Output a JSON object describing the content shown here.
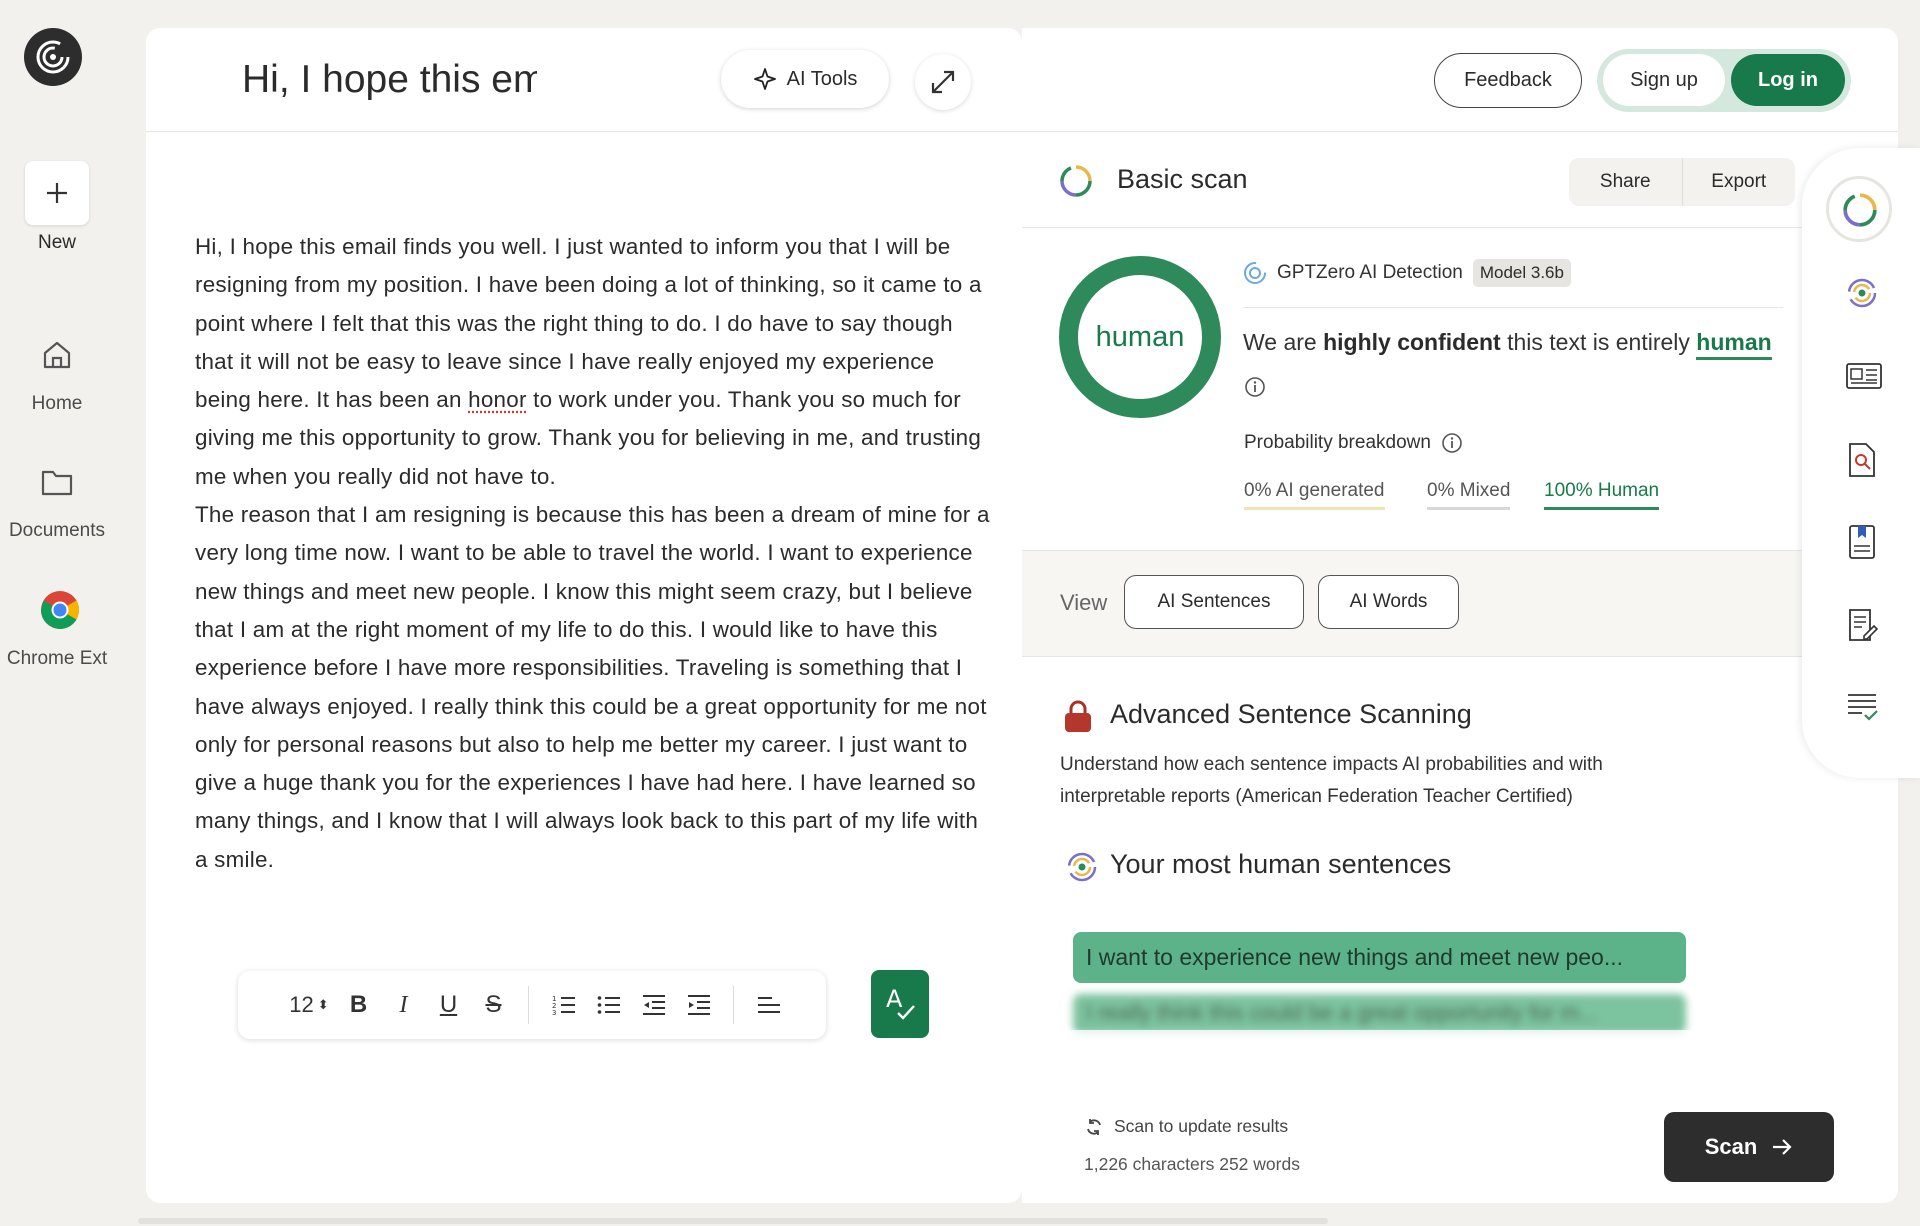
{
  "nav": {
    "new_label": "New",
    "home_label": "Home",
    "documents_label": "Documents",
    "chrome_label": "Chrome Ext"
  },
  "editor": {
    "title": "Hi, I hope this email",
    "ai_tools_label": "AI Tools",
    "body_p1_a": "Hi, I hope this email finds you well. I just wanted to inform you that I will be resigning from my position. I have been doing a lot of thinking, so it came to a point where I felt that this was the right thing to do. I do have to say though that it will not be easy to leave since I have really enjoyed my experience being here. It has been an ",
    "body_p1_flag": "honor",
    "body_p1_b": " to work under you. Thank you so much for giving me this opportunity to grow. Thank you for believing in me, and trusting me when you really did not have to.",
    "body_p2": "The reason that I am resigning is because this has been a dream of mine for a very long time now. I want to be able to travel the world. I want to experience new things and meet new people. I know this might seem crazy, but I believe that I am at the right moment of my life to do this. I would like to have this experience before I have more responsibilities. Traveling is something that I have always enjoyed. I really think this could be a great opportunity for me not only for personal reasons but also to help me better my career. I just want to give a huge thank you for the experiences I have had here. I have learned so many things, and I know that I will always look back to this part of my life with a smile.",
    "font_size": "12"
  },
  "header": {
    "feedback_label": "Feedback",
    "signup_label": "Sign up",
    "login_label": "Log in"
  },
  "scan": {
    "title": "Basic scan",
    "share_label": "Share",
    "export_label": "Export",
    "gauge_label": "human",
    "detector_name": "GPTZero AI Detection",
    "model_badge": "Model 3.6b",
    "confidence_prefix": "We are ",
    "confidence_strong": "highly confident",
    "confidence_middle": " this text is entirely ",
    "confidence_verdict": "human",
    "prob_label": "Probability breakdown",
    "prob_ai": "0% AI generated",
    "prob_mixed": "0% Mixed",
    "prob_human": "100% Human",
    "view_label": "View",
    "chip_sentences": "AI Sentences",
    "chip_words": "AI Words"
  },
  "advanced": {
    "title": "Advanced Sentence Scanning",
    "description": "Understand how each sentence impacts AI probabilities and with interpretable reports (American Federation Teacher Certified)",
    "human_title": "Your most human sentences",
    "sentence_1": "I want to experience new things and meet new peo...",
    "sentence_2": "I really think this could be a great opportunity for m...",
    "scan_update": "Scan to update results",
    "counts": "1,226 characters 252 words",
    "scan_button": "Scan"
  },
  "colors": {
    "brand_green": "#187a4a",
    "human_green": "#2e8a5a",
    "dark": "#2d2d2d"
  },
  "icons": [
    "logo-icon",
    "plus-icon",
    "home-icon",
    "folder-icon",
    "chrome-icon",
    "sparkle-icon",
    "expand-icon",
    "scan-ring-icon",
    "info-icon",
    "lock-icon",
    "refresh-icon",
    "arrow-right-icon"
  ]
}
